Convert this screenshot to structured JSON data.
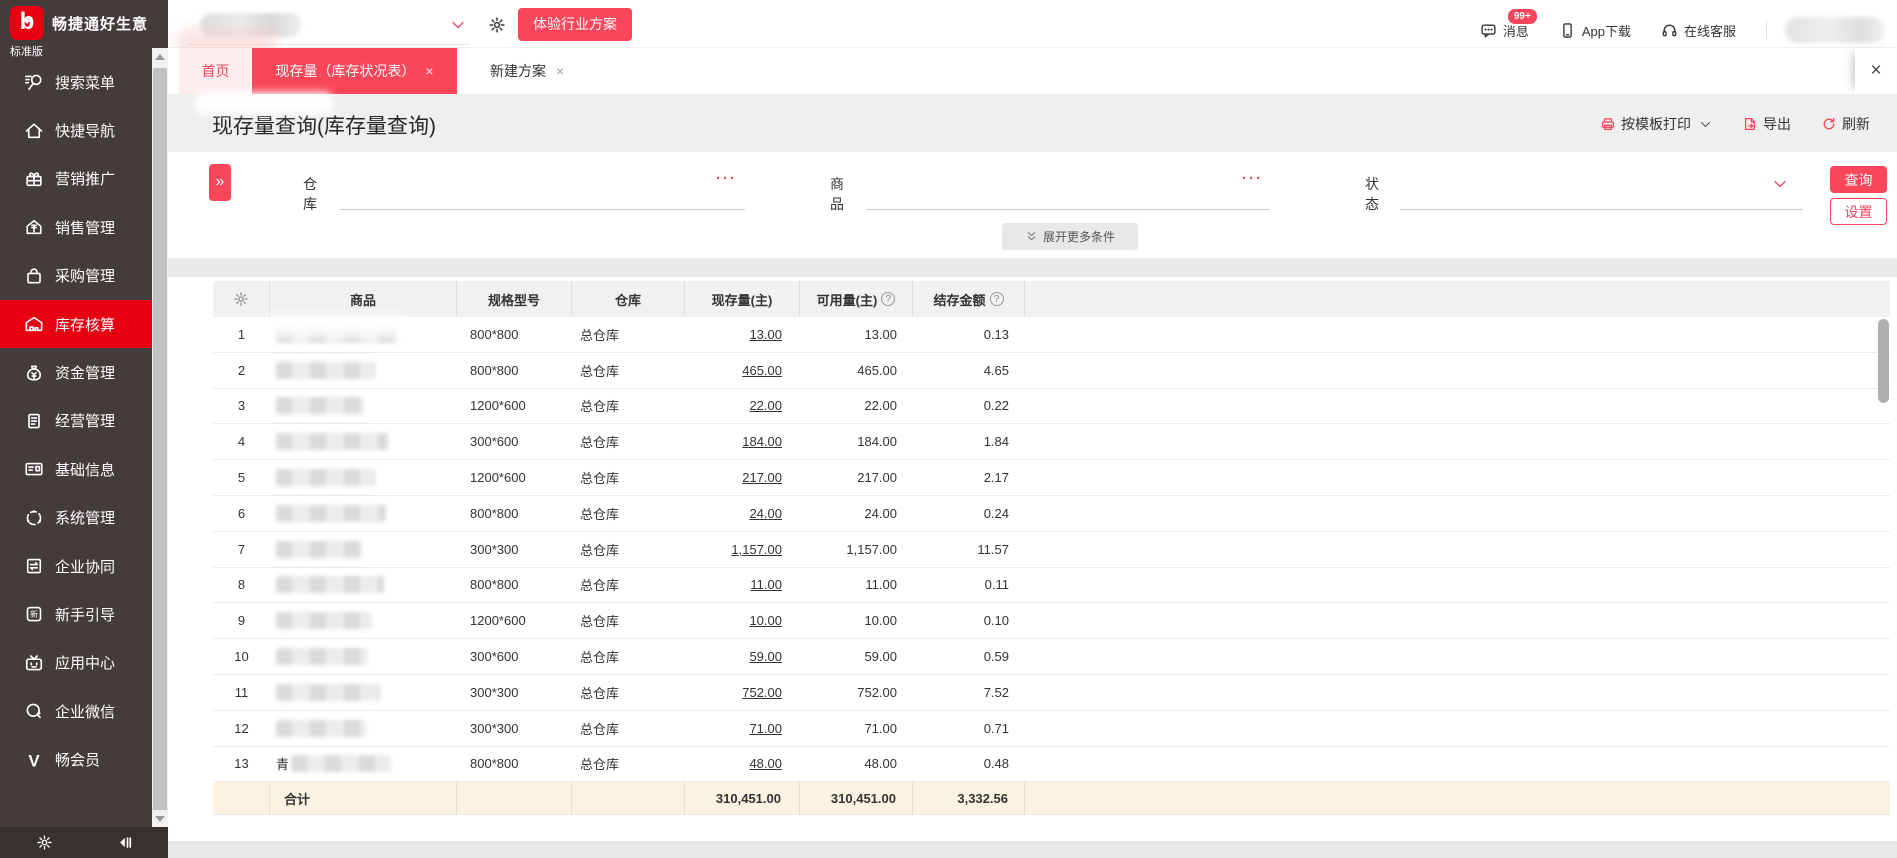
{
  "brand": {
    "logo_glyph": "b",
    "name": "畅捷通好生意",
    "edition": "标准版"
  },
  "topbar": {
    "trial_button": "体验行业方案",
    "nav_items": [
      {
        "icon": "message-bubble-icon",
        "label": "消息",
        "badge": "99+"
      },
      {
        "icon": "phone-icon",
        "label": "App下载"
      },
      {
        "icon": "headset-icon",
        "label": "在线客服"
      }
    ]
  },
  "tabs": [
    {
      "label": "首页",
      "style": "home",
      "active": false,
      "closable": false
    },
    {
      "label": "现存量（库存状况表）",
      "style": "active",
      "active": true,
      "closable": true
    },
    {
      "label": "新建方案",
      "style": "plain",
      "active": false,
      "closable": true
    }
  ],
  "tabbar_close_glyph": "×",
  "page": {
    "title": "现存量查询(库存量查询)",
    "toolbar": [
      {
        "icon": "printer-icon",
        "label": "按模板打印",
        "dropdown": true
      },
      {
        "icon": "export-icon",
        "label": "导出",
        "dropdown": false
      },
      {
        "icon": "refresh-icon",
        "label": "刷新",
        "dropdown": false
      }
    ]
  },
  "filters": {
    "fields": [
      {
        "label": "仓库",
        "suffix": "ellipsis"
      },
      {
        "label": "商品",
        "suffix": "ellipsis"
      },
      {
        "label": "状态",
        "suffix": "chevron"
      }
    ],
    "ellipsis_glyph": "···",
    "query_button": "查询",
    "settings_button": "设置",
    "expand_more": "展开更多条件",
    "expander_glyph": "»"
  },
  "grid": {
    "headers": [
      {
        "key": "no",
        "label": "",
        "icon": "gear-icon"
      },
      {
        "key": "product",
        "label": "商品"
      },
      {
        "key": "spec",
        "label": "规格型号"
      },
      {
        "key": "warehouse",
        "label": "仓库"
      },
      {
        "key": "qty",
        "label": "现存量(主)",
        "help": false
      },
      {
        "key": "available",
        "label": "可用量(主)",
        "help": true
      },
      {
        "key": "amount",
        "label": "结存金额",
        "help": true
      }
    ],
    "rows": [
      {
        "no": "1",
        "product_redacted": true,
        "spec": "800*800",
        "warehouse": "总仓库",
        "qty": "13.00",
        "available": "13.00",
        "amount": "0.13"
      },
      {
        "no": "2",
        "product_redacted": true,
        "spec": "800*800",
        "warehouse": "总仓库",
        "qty": "465.00",
        "available": "465.00",
        "amount": "4.65"
      },
      {
        "no": "3",
        "product_redacted": true,
        "spec": "1200*600",
        "warehouse": "总仓库",
        "qty": "22.00",
        "available": "22.00",
        "amount": "0.22"
      },
      {
        "no": "4",
        "product_redacted": true,
        "spec": "300*600",
        "warehouse": "总仓库",
        "qty": "184.00",
        "available": "184.00",
        "amount": "1.84"
      },
      {
        "no": "5",
        "product_redacted": true,
        "spec": "1200*600",
        "warehouse": "总仓库",
        "qty": "217.00",
        "available": "217.00",
        "amount": "2.17"
      },
      {
        "no": "6",
        "product_redacted": true,
        "spec": "800*800",
        "warehouse": "总仓库",
        "qty": "24.00",
        "available": "24.00",
        "amount": "0.24"
      },
      {
        "no": "7",
        "product_redacted": true,
        "spec": "300*300",
        "warehouse": "总仓库",
        "qty": "1,157.00",
        "available": "1,157.00",
        "amount": "11.57"
      },
      {
        "no": "8",
        "product_redacted": true,
        "spec": "800*800",
        "warehouse": "总仓库",
        "qty": "11.00",
        "available": "11.00",
        "amount": "0.11"
      },
      {
        "no": "9",
        "product_redacted": true,
        "spec": "1200*600",
        "warehouse": "总仓库",
        "qty": "10.00",
        "available": "10.00",
        "amount": "0.10"
      },
      {
        "no": "10",
        "product_redacted": true,
        "spec": "300*600",
        "warehouse": "总仓库",
        "qty": "59.00",
        "available": "59.00",
        "amount": "0.59"
      },
      {
        "no": "11",
        "product_redacted": true,
        "spec": "300*300",
        "warehouse": "总仓库",
        "qty": "752.00",
        "available": "752.00",
        "amount": "7.52"
      },
      {
        "no": "12",
        "product_redacted": true,
        "spec": "300*300",
        "warehouse": "总仓库",
        "qty": "71.00",
        "available": "71.00",
        "amount": "0.71"
      },
      {
        "no": "13",
        "product_redacted": true,
        "product_prefix": "青",
        "spec": "800*800",
        "warehouse": "总仓库",
        "qty": "48.00",
        "available": "48.00",
        "amount": "0.48"
      }
    ],
    "total": {
      "label": "合计",
      "qty": "310,451.00",
      "available": "310,451.00",
      "amount": "3,332.56"
    }
  },
  "sidebar": {
    "items": [
      {
        "icon": "search-icon",
        "label": "搜索菜单",
        "active": false
      },
      {
        "icon": "home-icon",
        "label": "快捷导航",
        "active": false
      },
      {
        "icon": "gift-icon",
        "label": "营销推广",
        "active": false
      },
      {
        "icon": "sales-icon",
        "label": "销售管理",
        "active": false
      },
      {
        "icon": "purchase-icon",
        "label": "采购管理",
        "active": false
      },
      {
        "icon": "inventory-icon",
        "label": "库存核算",
        "active": true
      },
      {
        "icon": "funds-icon",
        "label": "资金管理",
        "active": false
      },
      {
        "icon": "operations-icon",
        "label": "经营管理",
        "active": false
      },
      {
        "icon": "baseinfo-icon",
        "label": "基础信息",
        "active": false
      },
      {
        "icon": "system-icon",
        "label": "系统管理",
        "active": false
      },
      {
        "icon": "collab-icon",
        "label": "企业协同",
        "active": false
      },
      {
        "icon": "newbie-icon",
        "label": "新手引导",
        "active": false
      },
      {
        "icon": "appcenter-icon",
        "label": "应用中心",
        "active": false
      },
      {
        "icon": "wechat-icon",
        "label": "企业微信",
        "active": false
      },
      {
        "icon": "member-icon",
        "label": "畅会员",
        "active": false
      }
    ]
  },
  "colors": {
    "primary_red": "#f8465a",
    "sidebar_active_red": "#e60012",
    "total_row_bg": "#fbf3e1",
    "sidebar_bg": "#433c3a"
  }
}
